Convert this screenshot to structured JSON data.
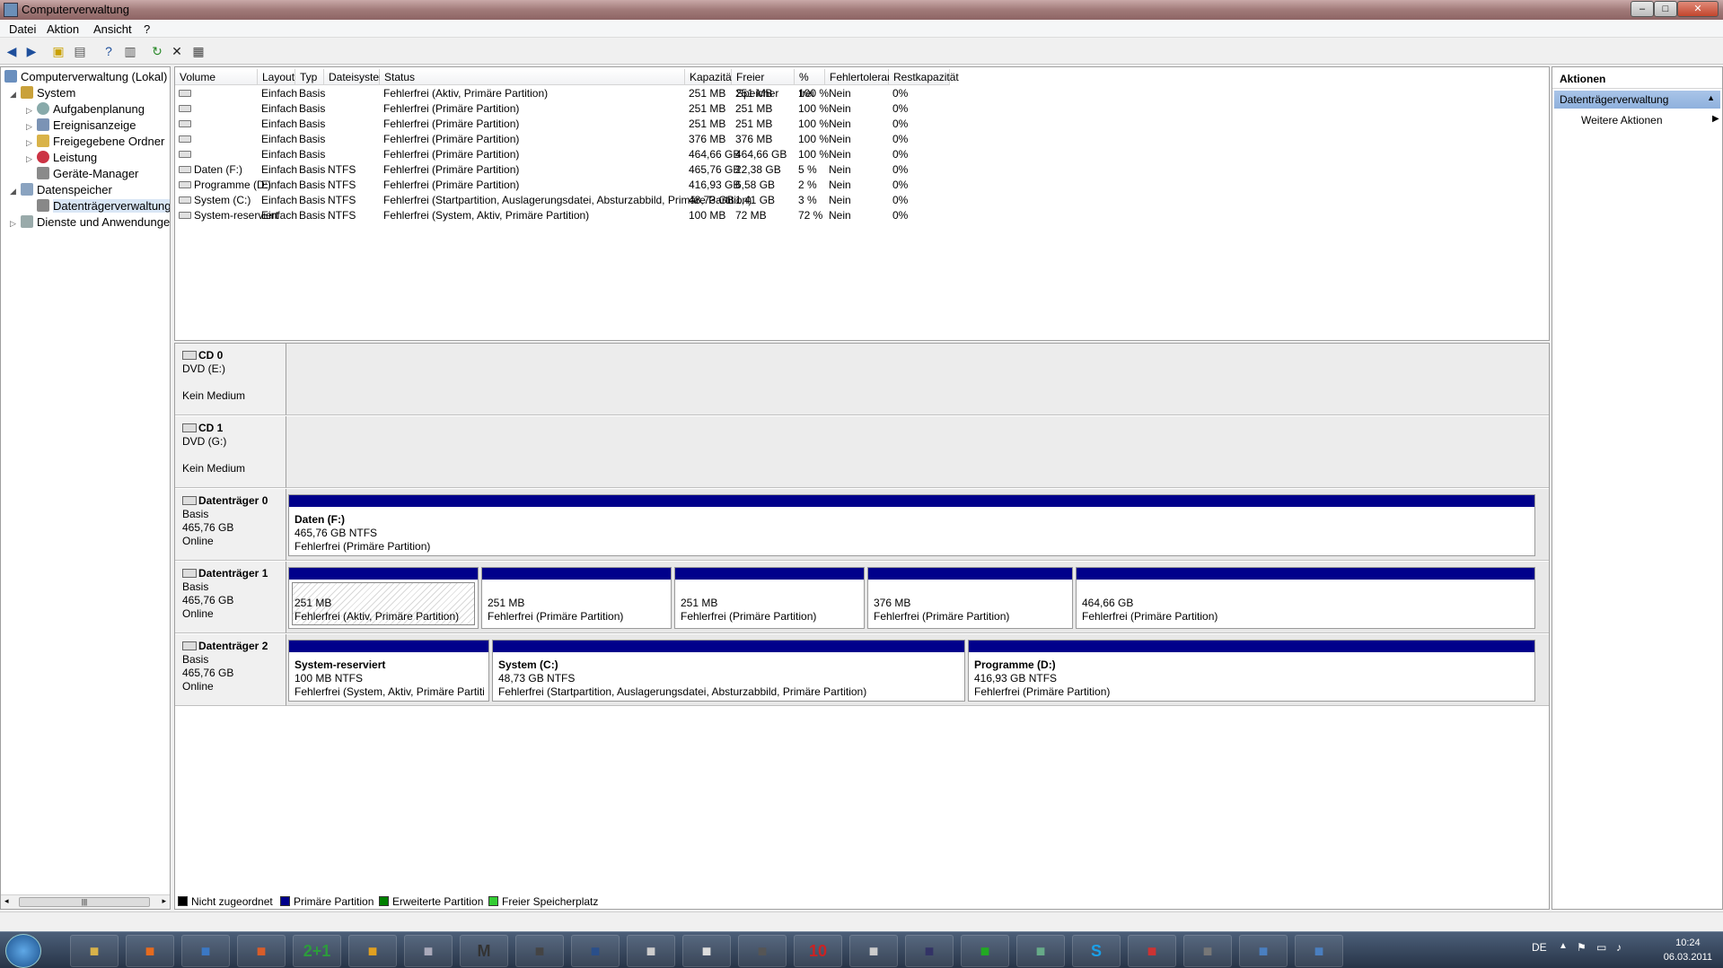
{
  "window": {
    "title": "Computerverwaltung"
  },
  "menu": [
    "Datei",
    "Aktion",
    "Ansicht",
    "?"
  ],
  "tree": [
    {
      "label": "Computerverwaltung (Lokal)",
      "icon": "computer-icon",
      "expanded": true
    },
    {
      "label": "System",
      "icon": "tools-icon",
      "expanded": true
    },
    {
      "label": "Aufgabenplanung",
      "icon": "clock-icon"
    },
    {
      "label": "Ereignisanzeige",
      "icon": "event-viewer-icon"
    },
    {
      "label": "Freigegebene Ordner",
      "icon": "shared-folder-icon"
    },
    {
      "label": "Leistung",
      "icon": "performance-icon"
    },
    {
      "label": "Geräte-Manager",
      "icon": "device-manager-icon"
    },
    {
      "label": "Datenspeicher",
      "icon": "storage-icon",
      "expanded": true
    },
    {
      "label": "Datenträgerverwaltung",
      "icon": "disk-management-icon",
      "selected": true
    },
    {
      "label": "Dienste und Anwendungen",
      "icon": "services-icon"
    }
  ],
  "volumes": {
    "columns": [
      "Volume",
      "Layout",
      "Typ",
      "Dateisystem",
      "Status",
      "Kapazität",
      "Freier Speicher",
      "% frei",
      "Fehlertoleranz",
      "Restkapazität"
    ],
    "rows": [
      [
        "",
        "Einfach",
        "Basis",
        "",
        "Fehlerfrei (Aktiv, Primäre Partition)",
        "251 MB",
        "251 MB",
        "100 %",
        "Nein",
        "0%"
      ],
      [
        "",
        "Einfach",
        "Basis",
        "",
        "Fehlerfrei (Primäre Partition)",
        "251 MB",
        "251 MB",
        "100 %",
        "Nein",
        "0%"
      ],
      [
        "",
        "Einfach",
        "Basis",
        "",
        "Fehlerfrei (Primäre Partition)",
        "251 MB",
        "251 MB",
        "100 %",
        "Nein",
        "0%"
      ],
      [
        "",
        "Einfach",
        "Basis",
        "",
        "Fehlerfrei (Primäre Partition)",
        "376 MB",
        "376 MB",
        "100 %",
        "Nein",
        "0%"
      ],
      [
        "",
        "Einfach",
        "Basis",
        "",
        "Fehlerfrei (Primäre Partition)",
        "464,66 GB",
        "464,66 GB",
        "100 %",
        "Nein",
        "0%"
      ],
      [
        "Daten (F:)",
        "Einfach",
        "Basis",
        "NTFS",
        "Fehlerfrei (Primäre Partition)",
        "465,76 GB",
        "22,38 GB",
        "5 %",
        "Nein",
        "0%"
      ],
      [
        "Programme (D:)",
        "Einfach",
        "Basis",
        "NTFS",
        "Fehlerfrei (Primäre Partition)",
        "416,93 GB",
        "6,58 GB",
        "2 %",
        "Nein",
        "0%"
      ],
      [
        "System (C:)",
        "Einfach",
        "Basis",
        "NTFS",
        "Fehlerfrei (Startpartition, Auslagerungsdatei, Absturzabbild, Primäre Partition)",
        "48,73 GB",
        "1,41 GB",
        "3 %",
        "Nein",
        "0%"
      ],
      [
        "System-reserviert",
        "Einfach",
        "Basis",
        "NTFS",
        "Fehlerfrei (System, Aktiv, Primäre Partition)",
        "100 MB",
        "72 MB",
        "72 %",
        "Nein",
        "0%"
      ]
    ]
  },
  "disks": [
    {
      "name": "CD 0",
      "lines": [
        "DVD (E:)",
        "",
        "Kein Medium"
      ],
      "partitions": []
    },
    {
      "name": "CD 1",
      "lines": [
        "DVD (G:)",
        "",
        "Kein Medium"
      ],
      "partitions": []
    },
    {
      "name": "Datenträger 0",
      "lines": [
        "Basis",
        "465,76 GB",
        "Online"
      ],
      "partitions": [
        {
          "title": "Daten  (F:)",
          "size": "465,76 GB NTFS",
          "status": "Fehlerfrei (Primäre Partition)"
        }
      ]
    },
    {
      "name": "Datenträger 1",
      "lines": [
        "Basis",
        "465,76 GB",
        "Online"
      ],
      "partitions": [
        {
          "title": "",
          "size": "251 MB",
          "status": "Fehlerfrei (Aktiv, Primäre Partition)",
          "active": true
        },
        {
          "title": "",
          "size": "251 MB",
          "status": "Fehlerfrei (Primäre Partition)"
        },
        {
          "title": "",
          "size": "251 MB",
          "status": "Fehlerfrei (Primäre Partition)"
        },
        {
          "title": "",
          "size": "376 MB",
          "status": "Fehlerfrei (Primäre Partition)"
        },
        {
          "title": "",
          "size": "464,66 GB",
          "status": "Fehlerfrei (Primäre Partition)"
        }
      ]
    },
    {
      "name": "Datenträger 2",
      "lines": [
        "Basis",
        "465,76 GB",
        "Online"
      ],
      "partitions": [
        {
          "title": "System-reserviert",
          "size": "100 MB NTFS",
          "status": "Fehlerfrei (System, Aktiv, Primäre Partitic"
        },
        {
          "title": "System  (C:)",
          "size": "48,73 GB NTFS",
          "status": "Fehlerfrei (Startpartition, Auslagerungsdatei, Absturzabbild, Primäre Partition)"
        },
        {
          "title": "Programme  (D:)",
          "size": "416,93 GB NTFS",
          "status": "Fehlerfrei (Primäre Partition)"
        }
      ]
    }
  ],
  "legend": [
    {
      "label": "Nicht zugeordnet",
      "color": "#000000"
    },
    {
      "label": "Primäre Partition",
      "color": "#00008b"
    },
    {
      "label": "Erweiterte Partition",
      "color": "#008000"
    },
    {
      "label": "Freier Speicherplatz",
      "color": "#33cc33"
    }
  ],
  "actions": {
    "header": "Aktionen",
    "section": "Datenträgerverwaltung",
    "item": "Weitere Aktionen"
  },
  "taskbar": {
    "apps": [
      "explorer-icon",
      "firefox-icon",
      "thunderbird-icon",
      "media-player-icon",
      "2p1-icon",
      "info-icon",
      "rating-icon",
      "m-icon",
      "helmet-icon",
      "shield-icon",
      "star-icon",
      "notepad-icon",
      "ninja-icon",
      "10-icon",
      "star2-icon",
      "moon-icon",
      "play-icon",
      "network-icon",
      "skype-icon",
      "toolbox-icon",
      "archive-icon",
      "computer-icon",
      "disk-mgmt-icon"
    ],
    "labels": {
      "2p1-icon": "2+1",
      "m-icon": "M",
      "10-icon": "10",
      "skype-icon": "S"
    },
    "lang": "DE",
    "time": "10:24",
    "date": "06.03.2011"
  }
}
